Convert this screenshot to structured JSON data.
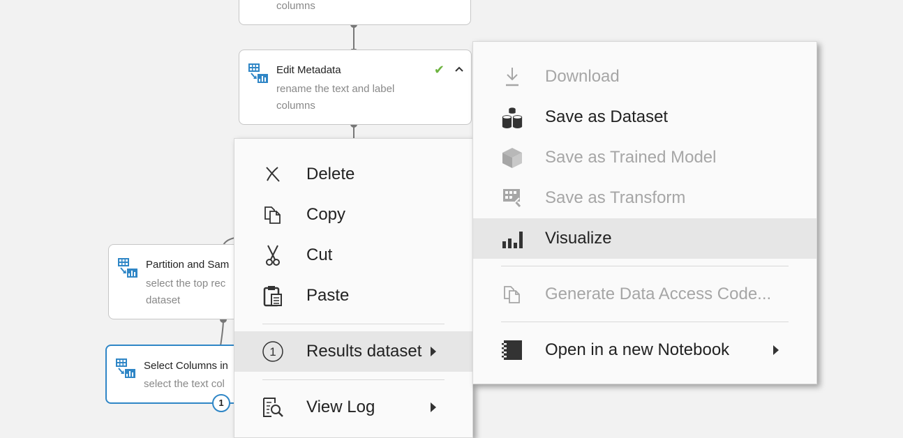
{
  "nodes": {
    "top": {
      "desc": "columns"
    },
    "edit_metadata": {
      "title": "Edit Metadata",
      "desc": "rename the text and label columns"
    },
    "partition": {
      "title": "Partition and Sam",
      "desc": "select the top rec dataset"
    },
    "select_columns": {
      "title": "Select Columns in",
      "desc": "select the text col",
      "badge": "1"
    }
  },
  "context_menu": {
    "items": [
      {
        "label": "Delete",
        "icon": "delete-x-icon"
      },
      {
        "label": "Copy",
        "icon": "copy-icon"
      },
      {
        "label": "Cut",
        "icon": "scissors-icon"
      },
      {
        "label": "Paste",
        "icon": "paste-icon"
      },
      {
        "label": "Results dataset",
        "icon": "port-1-icon",
        "port": "1"
      },
      {
        "label": "View Log",
        "icon": "view-log-icon"
      }
    ]
  },
  "submenu": {
    "items": [
      {
        "label": "Download",
        "icon": "download-icon",
        "enabled": false
      },
      {
        "label": "Save as Dataset",
        "icon": "save-dataset-icon",
        "enabled": true
      },
      {
        "label": "Save as Trained Model",
        "icon": "trained-model-icon",
        "enabled": false
      },
      {
        "label": "Save as Transform",
        "icon": "transform-icon",
        "enabled": false
      },
      {
        "label": "Visualize",
        "icon": "visualize-icon",
        "enabled": true
      },
      {
        "label": "Generate Data Access Code...",
        "icon": "data-access-code-icon",
        "enabled": false
      },
      {
        "label": "Open in a new Notebook",
        "icon": "notebook-icon",
        "enabled": true
      }
    ]
  },
  "colors": {
    "accent": "#2f86c6",
    "check": "#6db33f",
    "disabled_text": "#a6a6a6",
    "highlight": "#e6e6e6",
    "module_icon": "#2f86c6"
  }
}
